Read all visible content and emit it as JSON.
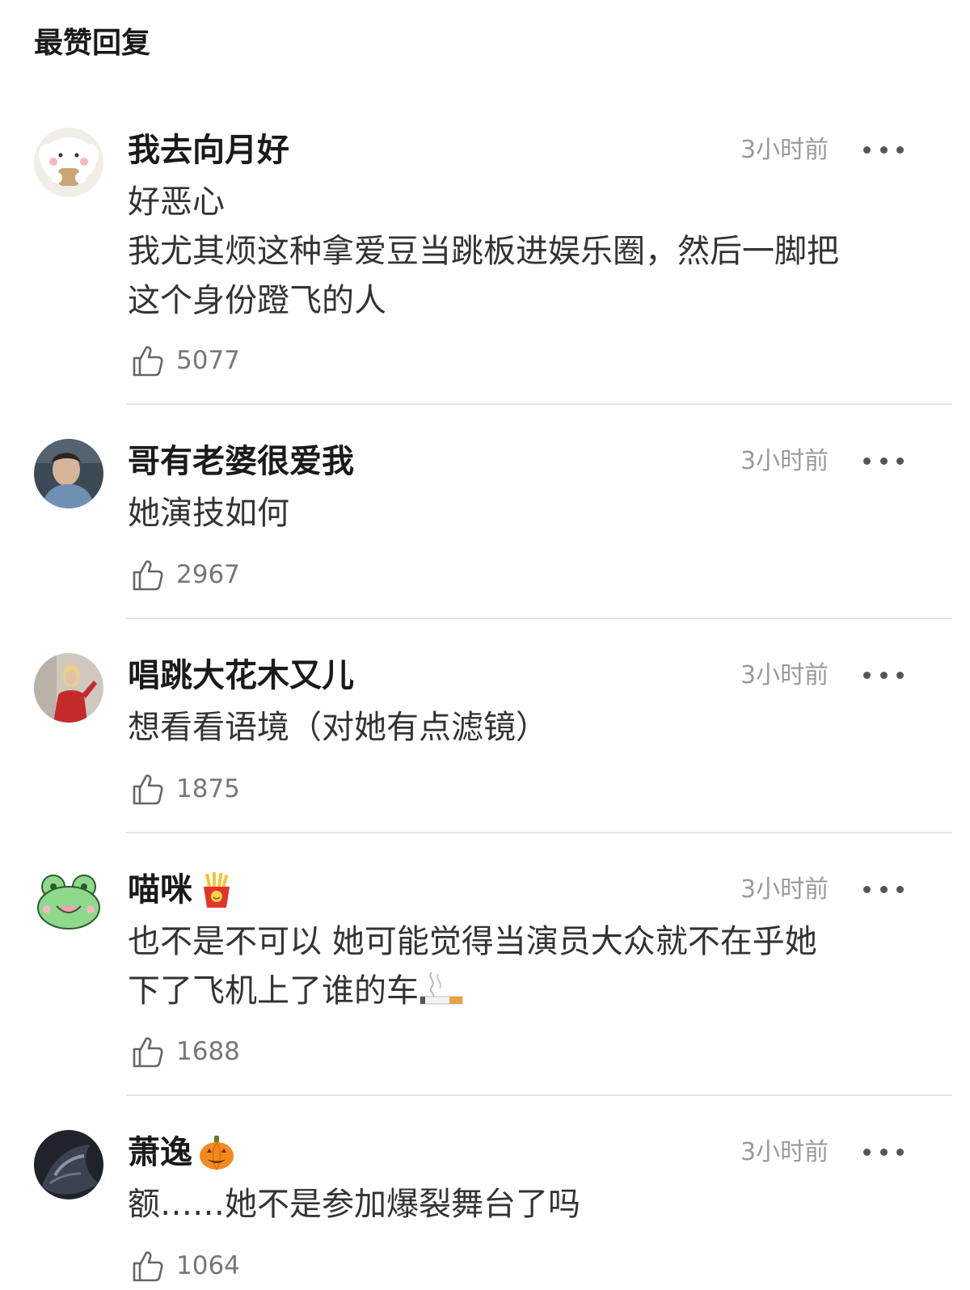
{
  "header": {
    "title": "最赞回复"
  },
  "comments": [
    {
      "username": "我去向月好",
      "time": "3小时前",
      "lines": [
        "好恶心",
        "我尤其烦这种拿爱豆当跳板进娱乐圈，然后一脚把",
        "这个身份蹬飞的人"
      ],
      "likes": "5077",
      "emoji": ""
    },
    {
      "username": "哥有老婆很爱我",
      "time": "3小时前",
      "lines": [
        "她演技如何"
      ],
      "likes": "2967",
      "emoji": ""
    },
    {
      "username": "唱跳大花木又儿",
      "time": "3小时前",
      "lines": [
        "想看看语境（对她有点滤镜）"
      ],
      "likes": "1875",
      "emoji": ""
    },
    {
      "username": "喵咪",
      "time": "3小时前",
      "lines": [
        "也不是不可以 她可能觉得当演员大众就不在乎她",
        "下了飞机上了谁的车"
      ],
      "likes": "1688",
      "emoji": "fries-emoji"
    },
    {
      "username": "萧逸",
      "time": "3小时前",
      "lines": [
        "额……她不是参加爆裂舞台了吗"
      ],
      "likes": "1064",
      "emoji": "pumpkin-emoji"
    }
  ],
  "icons": {
    "like": "thumbs-up-icon",
    "more": "more-dots-icon",
    "smoking": "cigarette-icon"
  },
  "colors": {
    "text": "#333333",
    "muted": "#9a9a9a",
    "divider": "#e6e6e6"
  }
}
